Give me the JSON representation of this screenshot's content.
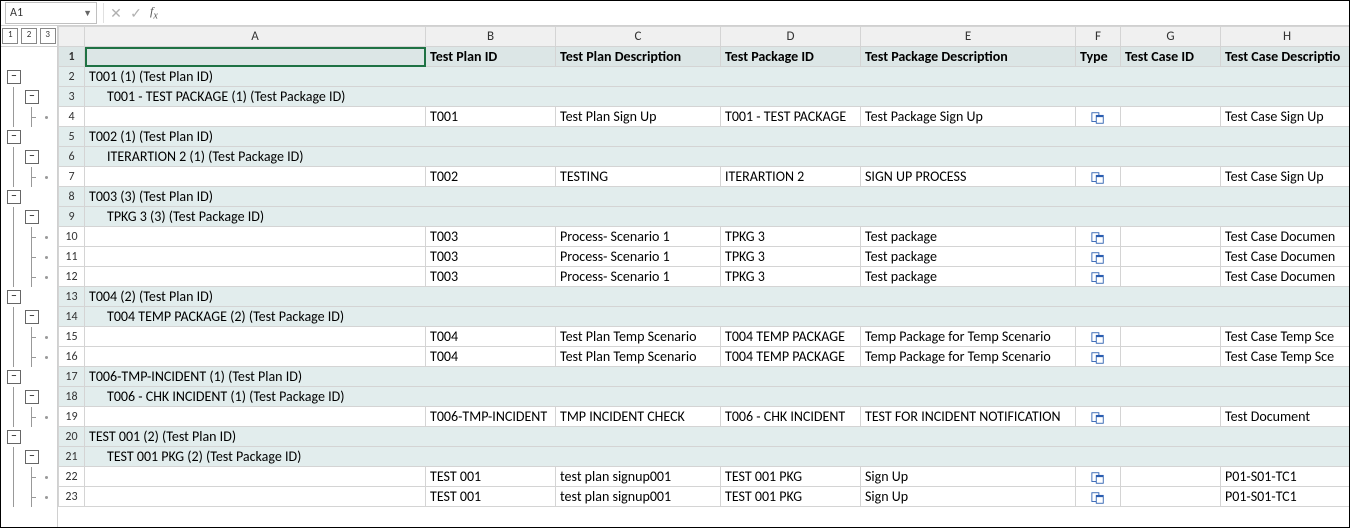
{
  "namebox": "A1",
  "outline_levels": [
    "1",
    "2",
    "3"
  ],
  "columns": [
    "A",
    "B",
    "C",
    "D",
    "E",
    "F",
    "G",
    "H"
  ],
  "header": {
    "A": "",
    "B": "Test Plan ID",
    "C": "Test Plan Description",
    "D": "Test Package ID",
    "E": "Test Package Description",
    "F": "Type",
    "G": "Test Case ID",
    "H": "Test Case Descriptio"
  },
  "rows": [
    {
      "n": "2",
      "kind": "grp",
      "A": "T001 (1) (Test Plan ID)"
    },
    {
      "n": "3",
      "kind": "sub",
      "A": "T001 - TEST PACKAGE (1) (Test Package ID)"
    },
    {
      "n": "4",
      "kind": "data",
      "B": "T001",
      "C": "Test Plan Sign Up",
      "D": "T001 - TEST PACKAGE",
      "E": "Test Package Sign Up",
      "F": "icon",
      "H": "Test Case Sign Up"
    },
    {
      "n": "5",
      "kind": "grp",
      "A": "T002 (1) (Test Plan ID)"
    },
    {
      "n": "6",
      "kind": "sub",
      "A": "ITERARTION 2 (1) (Test Package ID)"
    },
    {
      "n": "7",
      "kind": "data",
      "B": "T002",
      "C": "TESTING",
      "D": "ITERARTION 2",
      "E": "SIGN UP PROCESS",
      "F": "icon",
      "H": "Test Case Sign Up"
    },
    {
      "n": "8",
      "kind": "grp",
      "A": "T003 (3) (Test Plan ID)"
    },
    {
      "n": "9",
      "kind": "sub",
      "A": "TPKG 3 (3) (Test Package ID)"
    },
    {
      "n": "10",
      "kind": "data",
      "B": "T003",
      "C": "Process- Scenario 1",
      "D": "TPKG 3",
      "E": "Test package",
      "F": "icon",
      "H": "Test Case Documen"
    },
    {
      "n": "11",
      "kind": "data",
      "B": "T003",
      "C": "Process- Scenario 1",
      "D": "TPKG 3",
      "E": "Test package",
      "F": "icon",
      "H": "Test Case Documen"
    },
    {
      "n": "12",
      "kind": "data",
      "B": "T003",
      "C": "Process- Scenario 1",
      "D": "TPKG 3",
      "E": "Test package",
      "F": "icon",
      "H": "Test Case Documen"
    },
    {
      "n": "13",
      "kind": "grp",
      "A": "T004 (2) (Test Plan ID)"
    },
    {
      "n": "14",
      "kind": "sub",
      "A": "T004 TEMP PACKAGE (2) (Test Package ID)"
    },
    {
      "n": "15",
      "kind": "data",
      "B": "T004",
      "C": "Test Plan Temp Scenario",
      "D": "T004 TEMP PACKAGE",
      "E": "Temp Package for Temp Scenario",
      "F": "icon",
      "H": "Test Case Temp Sce"
    },
    {
      "n": "16",
      "kind": "data",
      "B": "T004",
      "C": "Test Plan Temp Scenario",
      "D": "T004 TEMP PACKAGE",
      "E": "Temp Package for Temp Scenario",
      "F": "icon",
      "H": "Test Case Temp Sce"
    },
    {
      "n": "17",
      "kind": "grp",
      "A": "T006-TMP-INCIDENT (1) (Test Plan ID)"
    },
    {
      "n": "18",
      "kind": "sub",
      "A": "T006 - CHK INCIDENT (1) (Test Package ID)"
    },
    {
      "n": "19",
      "kind": "data",
      "B": "T006-TMP-INCIDENT",
      "C": "TMP INCIDENT CHECK",
      "D": "T006 - CHK INCIDENT",
      "E": "TEST FOR INCIDENT NOTIFICATION",
      "F": "icon",
      "H": "Test Document"
    },
    {
      "n": "20",
      "kind": "grp",
      "A": "TEST 001 (2) (Test Plan ID)"
    },
    {
      "n": "21",
      "kind": "sub",
      "A": "TEST 001 PKG (2) (Test Package ID)"
    },
    {
      "n": "22",
      "kind": "data",
      "B": "TEST 001",
      "C": "test plan signup001",
      "D": "TEST 001 PKG",
      "E": "Sign Up",
      "F": "icon",
      "H": "P01-S01-TC1"
    },
    {
      "n": "23",
      "kind": "data",
      "B": "TEST 001",
      "C": "test plan signup001",
      "D": "TEST 001 PKG",
      "E": "Sign Up",
      "F": "icon",
      "H": "P01-S01-TC1"
    }
  ],
  "outline": [
    {
      "row": 0,
      "hdr": true
    },
    {
      "row": 1
    },
    {
      "row": 2,
      "box": 1,
      "minus": true
    },
    {
      "row": 3,
      "box": 2,
      "minus": true,
      "v1": true
    },
    {
      "row": 4,
      "v1": true,
      "v2": true,
      "leaf": true
    },
    {
      "row": 5,
      "box": 1,
      "minus": true
    },
    {
      "row": 6,
      "box": 2,
      "minus": true,
      "v1": true
    },
    {
      "row": 7,
      "v1": true,
      "v2": true,
      "leaf": true
    },
    {
      "row": 8,
      "box": 1,
      "minus": true
    },
    {
      "row": 9,
      "box": 2,
      "minus": true,
      "v1": true
    },
    {
      "row": 10,
      "v1": true,
      "v2": true,
      "leaf": true
    },
    {
      "row": 11,
      "v1": true,
      "v2": true,
      "leaf": true
    },
    {
      "row": 12,
      "v1": true,
      "v2": true,
      "leaf": true
    },
    {
      "row": 13,
      "box": 1,
      "minus": true
    },
    {
      "row": 14,
      "box": 2,
      "minus": true,
      "v1": true
    },
    {
      "row": 15,
      "v1": true,
      "v2": true,
      "leaf": true
    },
    {
      "row": 16,
      "v1": true,
      "v2": true,
      "leaf": true
    },
    {
      "row": 17,
      "box": 1,
      "minus": true
    },
    {
      "row": 18,
      "box": 2,
      "minus": true,
      "v1": true
    },
    {
      "row": 19,
      "v1": true,
      "v2": true,
      "leaf": true
    },
    {
      "row": 20,
      "box": 1,
      "minus": true
    },
    {
      "row": 21,
      "box": 2,
      "minus": true,
      "v1": true
    },
    {
      "row": 22,
      "v1": true,
      "v2": true,
      "leaf": true
    },
    {
      "row": 23,
      "v1": true,
      "v2": true,
      "leaf": true
    }
  ]
}
